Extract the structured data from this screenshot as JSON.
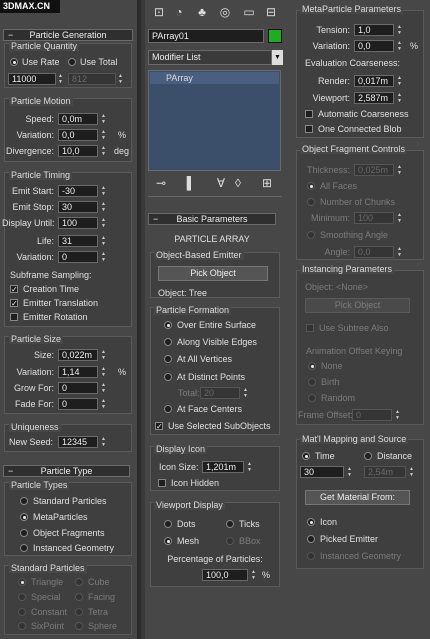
{
  "watermark": "3DMAX.CN",
  "top_icons": [
    "hierarchy-icon",
    "sphere-icon",
    "motion-icon",
    "display-icon",
    "monitor-icon",
    "utilities-icon"
  ],
  "left": {
    "particle_generation": {
      "title": "Particle Generation",
      "quantity_label": "Particle Quantity",
      "use_rate": "Use Rate",
      "use_total": "Use Total",
      "rate_value": "11000",
      "total_value": "812",
      "motion_title": "Particle Motion",
      "speed_label": "Speed:",
      "speed_value": "0,0m",
      "variation_label": "Variation:",
      "variation_value": "0,0",
      "pct": "%",
      "divergence_label": "Divergence:",
      "divergence_value": "10,0",
      "deg": "deg",
      "timing_title": "Particle Timing",
      "emit_start_label": "Emit Start:",
      "emit_start_value": "-30",
      "emit_stop_label": "Emit Stop:",
      "emit_stop_value": "30",
      "display_until_label": "Display Until:",
      "display_until_value": "100",
      "life_label": "Life:",
      "life_value": "31",
      "timing_var_label": "Variation:",
      "timing_var_value": "0",
      "subframe_label": "Subframe Sampling:",
      "creation_time": "Creation Time",
      "emitter_translation": "Emitter Translation",
      "emitter_rotation": "Emitter Rotation",
      "size_title": "Particle Size",
      "size_label": "Size:",
      "size_value": "0,022m",
      "size_var_label": "Variation:",
      "size_var_value": "1,14",
      "grow_for_label": "Grow For:",
      "grow_for_value": "0",
      "fade_for_label": "Fade For:",
      "fade_for_value": "0",
      "uniqueness_title": "Uniqueness",
      "new_seed_label": "New Seed:",
      "seed_value": "12345"
    },
    "particle_type": {
      "title": "Particle Type",
      "types_title": "Particle Types",
      "standard": "Standard Particles",
      "meta": "MetaParticles",
      "fragments": "Object Fragments",
      "instanced": "Instanced Geometry",
      "std_title": "Standard Particles",
      "triangle": "Triangle",
      "cube": "Cube",
      "special": "Special",
      "facing": "Facing",
      "constant": "Constant",
      "tetra": "Tetra",
      "sixpoint": "SixPoint",
      "sphere": "Sphere"
    }
  },
  "middle": {
    "object_name": "PArray01",
    "color": "#22aa22",
    "modifier_list": "Modifier List",
    "stack_item": "PArray",
    "stack_icons": [
      "pin-stack-icon",
      "show-end-result-icon",
      "make-unique-icon",
      "remove-modifier-icon",
      "configure-sets-icon"
    ],
    "basic_title": "Basic Parameters",
    "particle_array": "PARTICLE ARRAY",
    "emitter_title": "Object-Based Emitter",
    "pick_object": "Pick Object",
    "object_label": "Object: Tree",
    "formation_title": "Particle Formation",
    "over_faces": "Over Entire Surface",
    "visible_edges": "Along Visible Edges",
    "all_vertices": "At All Vertices",
    "distinct_points": "At Distinct Points",
    "total_label": "Total:",
    "total_value": "20",
    "face_centers": "At Face Centers",
    "use_selected": "Use Selected SubObjects",
    "display_icon_title": "Display Icon",
    "icon_size_label": "Icon Size:",
    "icon_size_value": "1,201m",
    "icon_hidden": "Icon Hidden",
    "viewport_title": "Viewport Display",
    "dots": "Dots",
    "ticks": "Ticks",
    "mesh": "Mesh",
    "bbox": "BBox",
    "percentage_label": "Percentage of Particles:",
    "percentage_value": "100,0",
    "pct": "%"
  },
  "right": {
    "meta_title": "MetaParticle Parameters",
    "tension_label": "Tension:",
    "tension_value": "1,0",
    "variation_label": "Variation:",
    "variation_value": "0,0",
    "pct": "%",
    "eval_label": "Evaluation Coarseness:",
    "render_label": "Render:",
    "render_value": "0,017m",
    "viewport_label": "Viewport:",
    "viewport_value": "2,587m",
    "auto_coarse": "Automatic Coarseness",
    "one_blob": "One Connected Blob",
    "frag_title": "Object Fragment Controls",
    "thickness_label": "Thickness:",
    "thickness_value": "0,025m",
    "all_faces": "All Faces",
    "num_chunks": "Number of Chunks",
    "minimum_label": "Minimum:",
    "minimum_value": "100",
    "smoothing": "Smoothing Angle",
    "angle_label": "Angle:",
    "angle_value": "0,0",
    "inst_title": "Instancing Parameters",
    "object_none": "Object: <None>",
    "pick_object": "Pick Object",
    "use_subtree": "Use Subtree Also",
    "anim_offset": "Animation Offset Keying",
    "none": "None",
    "birth": "Birth",
    "random": "Random",
    "frame_offset_label": "Frame Offset:",
    "frame_offset_value": "0",
    "mat_title": "Mat'l Mapping and Source",
    "time": "Time",
    "distance": "Distance",
    "time_value": "30",
    "distance_value": "2,54m",
    "get_material": "Get Material From:",
    "icon_src": "Icon",
    "picked_emitter": "Picked Emitter",
    "instanced_geometry": "Instanced Geometry"
  }
}
